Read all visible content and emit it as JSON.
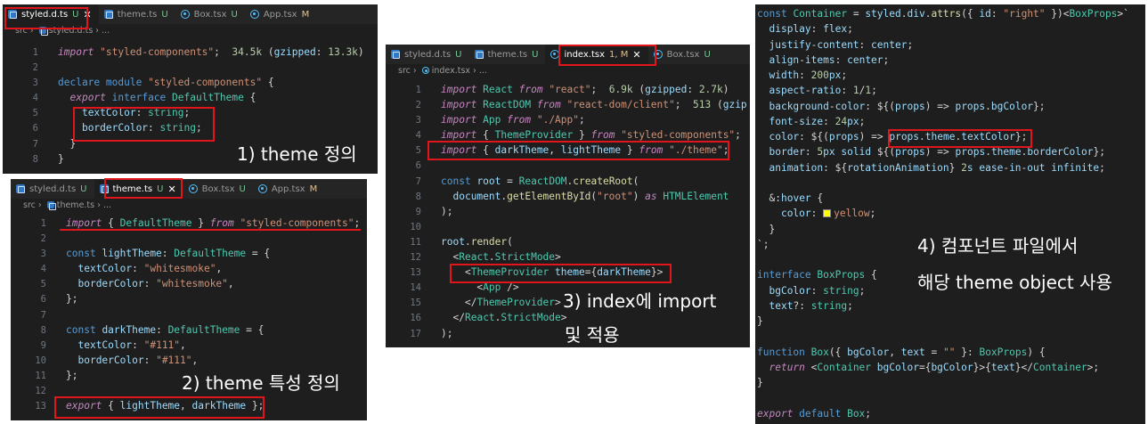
{
  "panel1": {
    "tabs": [
      {
        "name": "styled.d.ts",
        "status": "U",
        "active": true,
        "icon": "typescript-file-icon"
      },
      {
        "name": "theme.ts",
        "status": "U",
        "active": false,
        "icon": "typescript-file-icon"
      },
      {
        "name": "Box.tsx",
        "status": "U",
        "active": false,
        "icon": "react-file-icon"
      },
      {
        "name": "App.tsx",
        "status": "M",
        "active": false,
        "icon": "react-file-icon"
      }
    ],
    "breadcrumb": [
      "src",
      "styled.d.ts",
      "..."
    ],
    "caption": "1) theme 정의",
    "lines": [
      {
        "n": "1",
        "code": "import \"styled-components\";  34.5k (gzipped: 13.3k)"
      },
      {
        "n": "2",
        "code": ""
      },
      {
        "n": "3",
        "code": "declare module \"styled-components\" {"
      },
      {
        "n": "4",
        "code": "  export interface DefaultTheme {"
      },
      {
        "n": "5",
        "code": "    textColor: string;"
      },
      {
        "n": "6",
        "code": "    borderColor: string;"
      },
      {
        "n": "7",
        "code": "  }"
      },
      {
        "n": "8",
        "code": "}"
      }
    ]
  },
  "panel2": {
    "tabs": [
      {
        "name": "styled.d.ts",
        "status": "U",
        "active": false,
        "icon": "typescript-file-icon"
      },
      {
        "name": "theme.ts",
        "status": "U",
        "active": true,
        "icon": "typescript-file-icon"
      },
      {
        "name": "Box.tsx",
        "status": "U",
        "active": false,
        "icon": "react-file-icon"
      },
      {
        "name": "App.tsx",
        "status": "M",
        "active": false,
        "icon": "react-file-icon"
      }
    ],
    "breadcrumb": [
      "src",
      "theme.ts",
      "..."
    ],
    "caption": "2) theme 특성 정의",
    "lines": [
      {
        "n": "1",
        "code": "import { DefaultTheme } from \"styled-components\";"
      },
      {
        "n": "2",
        "code": ""
      },
      {
        "n": "3",
        "code": "const lightTheme: DefaultTheme = {"
      },
      {
        "n": "4",
        "code": "  textColor: \"whitesmoke\","
      },
      {
        "n": "5",
        "code": "  borderColor: \"whitesmoke\","
      },
      {
        "n": "6",
        "code": "};"
      },
      {
        "n": "7",
        "code": ""
      },
      {
        "n": "8",
        "code": "const darkTheme: DefaultTheme = {"
      },
      {
        "n": "9",
        "code": "  textColor: \"#111\","
      },
      {
        "n": "10",
        "code": "  borderColor: \"#111\","
      },
      {
        "n": "11",
        "code": "};"
      },
      {
        "n": "12",
        "code": ""
      },
      {
        "n": "13",
        "code": "export { lightTheme, darkTheme };"
      }
    ]
  },
  "panel3": {
    "tabs": [
      {
        "name": "styled.d.ts",
        "status": "U",
        "active": false,
        "icon": "typescript-file-icon"
      },
      {
        "name": "theme.ts",
        "status": "U",
        "active": false,
        "icon": "typescript-file-icon"
      },
      {
        "name": "index.tsx",
        "status": "1, M",
        "active": true,
        "icon": "react-file-icon"
      },
      {
        "name": "Box.tsx",
        "status": "U",
        "active": false,
        "icon": "react-file-icon"
      }
    ],
    "breadcrumb": [
      "src",
      "index.tsx",
      "..."
    ],
    "caption_line1": "3) index에 import",
    "caption_line2": "및 적용",
    "lines": [
      {
        "n": "1",
        "code": "import React from \"react\";  6.9k (gzipped: 2.7k)"
      },
      {
        "n": "2",
        "code": "import ReactDOM from \"react-dom/client\";  513 (gzip"
      },
      {
        "n": "3",
        "code": "import App from \"./App\";"
      },
      {
        "n": "4",
        "code": "import { ThemeProvider } from \"styled-components\";"
      },
      {
        "n": "5",
        "code": "import { darkTheme, lightTheme } from \"./theme\";"
      },
      {
        "n": "6",
        "code": ""
      },
      {
        "n": "7",
        "code": "const root = ReactDOM.createRoot("
      },
      {
        "n": "8",
        "code": "  document.getElementById(\"root\") as HTMLElement"
      },
      {
        "n": "9",
        "code": ");"
      },
      {
        "n": "10",
        "code": ""
      },
      {
        "n": "11",
        "code": "root.render("
      },
      {
        "n": "12",
        "code": "  <React.StrictMode>"
      },
      {
        "n": "13",
        "code": "    <ThemeProvider theme={darkTheme}>"
      },
      {
        "n": "14",
        "code": "      <App />"
      },
      {
        "n": "15",
        "code": "    </ThemeProvider>"
      },
      {
        "n": "16",
        "code": "  </React.StrictMode>"
      },
      {
        "n": "17",
        "code": ");"
      }
    ]
  },
  "panel4": {
    "caption_line1": "4) 컴포넌트 파일에서",
    "caption_line2": "해당 theme object 사용",
    "lines": [
      "const Container = styled.div.attrs({ id: \"right\" })<BoxProps>`",
      "  display: flex;",
      "  justify-content: center;",
      "  align-items: center;",
      "  width: 200px;",
      "  aspect-ratio: 1/1;",
      "  background-color: ${(props) => props.bgColor};",
      "  font-size: 24px;",
      "  color: ${(props) => props.theme.textColor};",
      "  border: 5px solid ${(props) => props.theme.borderColor};",
      "  animation: ${rotationAnimation} 2s ease-in-out infinite;",
      "",
      "  &:hover {",
      "    color: yellow;",
      "  }",
      "`;",
      "",
      "interface BoxProps {",
      "  bgColor: string;",
      "  text?: string;",
      "}",
      "",
      "function Box({ bgColor, text = \"\" }: BoxProps) {",
      "  return <Container bgColor={bgColor}>{text}</Container>;",
      "}",
      "",
      "export default Box;"
    ]
  },
  "colors": {
    "highlight_box": "#e1161d",
    "editor_bg": "#1e1e1e",
    "tab_bar_bg": "#252526"
  }
}
